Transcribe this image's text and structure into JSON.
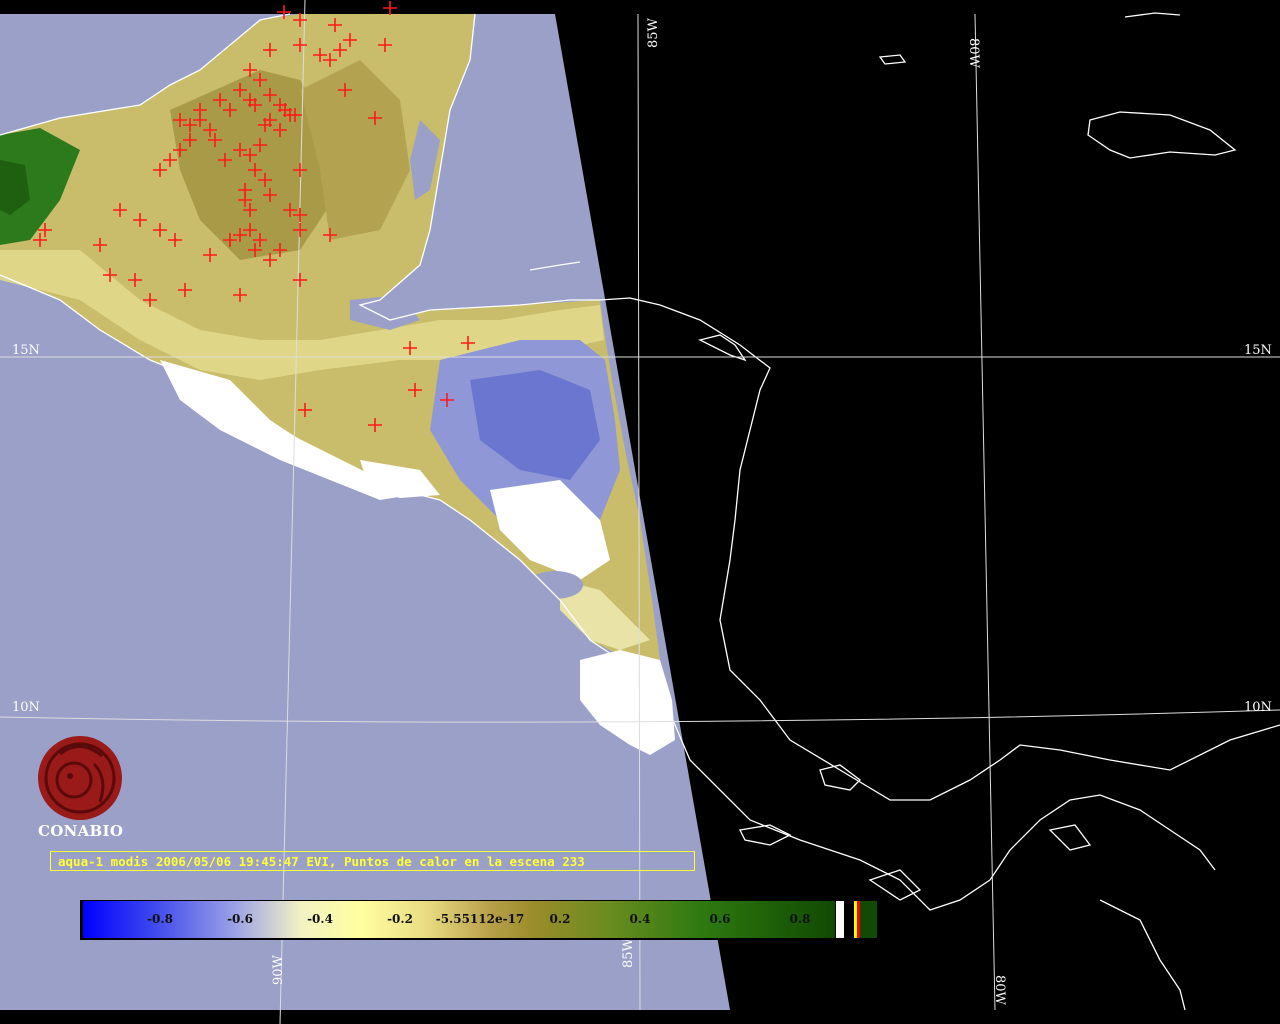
{
  "map": {
    "meridians": [
      {
        "label": "90W",
        "lon": -90
      },
      {
        "label": "85W",
        "lon": -85
      },
      {
        "label": "80W",
        "lon": -80
      }
    ],
    "parallels": [
      {
        "label": "15N",
        "lat": 15
      },
      {
        "label": "10N",
        "lat": 10
      }
    ],
    "colors": {
      "ocean_swath": "#9aa0c8",
      "night": "#000000",
      "coastline": "#ffffff",
      "graticule": "#ffffff",
      "hotspot": "#ff1a1a",
      "land_dry": "#c9b865",
      "land_veg": "#2f7a10",
      "cloud": "#ffffff"
    },
    "hotspot_count": 233
  },
  "logo": {
    "name": "CONABIO",
    "icon": "conabio-macaw-logo-icon"
  },
  "caption": "aqua-1 modis 2006/05/06 19:45:47 EVI, Puntos de calor en la escena 233",
  "colorbar": {
    "ticks": [
      "-0.8",
      "-0.6",
      "-0.4",
      "-0.2",
      "-5.55112e-17",
      "0.2",
      "0.4",
      "0.6",
      "0.8"
    ],
    "range": [
      -1,
      1
    ],
    "extra_swatch_colors": [
      "#ffffff",
      "#000000",
      "#ffff00",
      "#ff0000",
      "#000000"
    ]
  }
}
